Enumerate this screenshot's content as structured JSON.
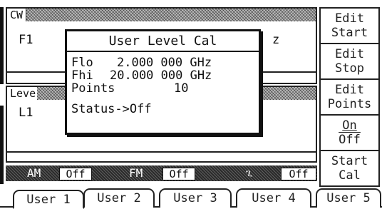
{
  "cw_panel": {
    "header": "CW",
    "freq_label": "F1",
    "freq_unit_tail": "z"
  },
  "level_panel": {
    "header": "Leve",
    "level_label": "L1"
  },
  "dialog": {
    "title": "User Level Cal",
    "flo_label": "Flo",
    "flo_value": "2.000 000 GHz",
    "fhi_label": "Fhi",
    "fhi_value": "20.000 000 GHz",
    "points_label": "Points",
    "points_value": "10",
    "status": "Status->Off"
  },
  "status_bar": {
    "am_label": "AM",
    "am_state": "Off",
    "fm_label": "FM",
    "fm_state": "Off",
    "pulse_symbol": "ጊ",
    "pulse_state": "Off"
  },
  "softkeys": {
    "edit_start": [
      "Edit",
      "Start"
    ],
    "edit_stop": [
      "Edit",
      "Stop"
    ],
    "edit_points": [
      "Edit",
      "Points"
    ],
    "on_off": [
      "On",
      "Off"
    ],
    "start_cal": [
      "Start",
      "Cal"
    ]
  },
  "tabs": [
    "User 1",
    "User 2",
    "User 3",
    "User 4",
    "User 5"
  ]
}
